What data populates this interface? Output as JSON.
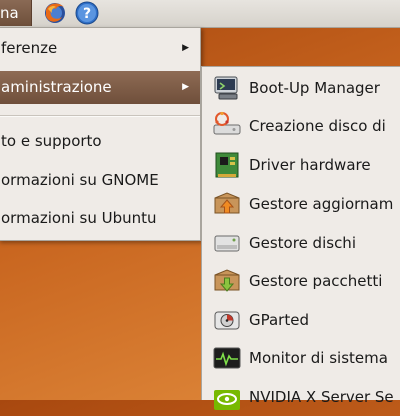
{
  "top_panel": {
    "menu_label": "na",
    "firefox_icon": "firefox-icon",
    "help_icon": "help-icon",
    "help_glyph": "?"
  },
  "main_menu": {
    "items": [
      {
        "label": "ferenze",
        "has_submenu": true
      },
      {
        "label": "aministrazione",
        "has_submenu": true,
        "active": true
      },
      {
        "label": "to e supporto"
      },
      {
        "label": "ormazioni su GNOME"
      },
      {
        "label": "ormazioni su Ubuntu"
      }
    ],
    "arrow_glyph": "▶"
  },
  "admin_submenu": {
    "items": [
      {
        "label": "Boot-Up Manager",
        "icon": "boot-up-manager-icon"
      },
      {
        "label": "Creazione disco di",
        "icon": "startup-disk-icon"
      },
      {
        "label": "Driver hardware",
        "icon": "hardware-driver-icon"
      },
      {
        "label": "Gestore aggiornam",
        "icon": "update-manager-icon"
      },
      {
        "label": "Gestore dischi",
        "icon": "disk-manager-icon"
      },
      {
        "label": "Gestore pacchetti",
        "icon": "package-manager-icon"
      },
      {
        "label": "GParted",
        "icon": "gparted-icon"
      },
      {
        "label": "Monitor di sistema",
        "icon": "system-monitor-icon"
      },
      {
        "label": "NVIDIA X Server Se",
        "icon": "nvidia-icon"
      }
    ]
  }
}
